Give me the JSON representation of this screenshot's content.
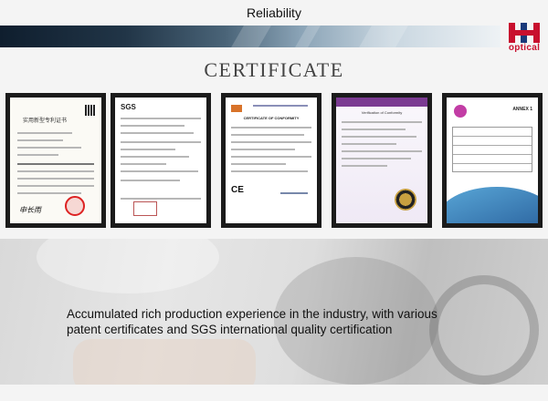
{
  "header": {
    "title": "Reliability",
    "logo_text": "optical",
    "logo_mark": "HH"
  },
  "section": {
    "heading": "CERTIFICATE"
  },
  "certificates": {
    "cert1": {
      "header": "实用新型专利证书",
      "signature": "申长雨"
    },
    "cert2": {
      "logo": "SGS"
    },
    "cert3": {
      "title": "CERTIFICATE OF CONFORMITY",
      "mark": "CE"
    },
    "cert4": {
      "header": "Verification of Conformity"
    },
    "cert5": {
      "title": "ANNEX 1"
    }
  },
  "caption": {
    "line1": "Accumulated rich production experience in the industry, with various",
    "line2": "patent certificates and SGS international quality certification"
  },
  "colors": {
    "brand_red": "#c8102e",
    "frame": "#1b1b1b",
    "banner_dark": "#0f1e2e"
  }
}
